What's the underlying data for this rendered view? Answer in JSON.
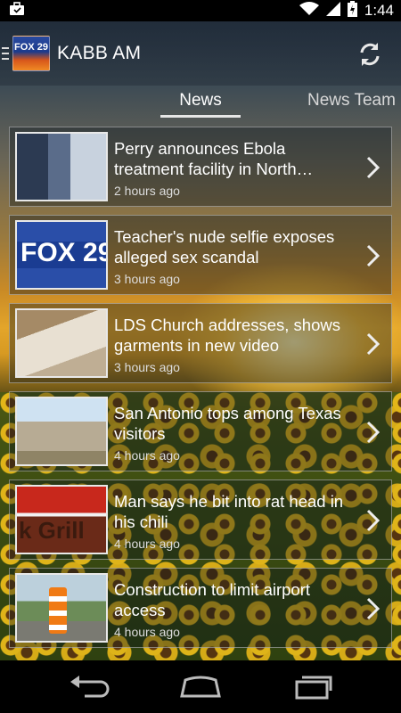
{
  "status_bar": {
    "time": "1:44",
    "left_icon": "briefcase-icon",
    "icons": [
      "wifi-icon",
      "signal-icon",
      "battery-charging-icon"
    ]
  },
  "action_bar": {
    "title": "KABB AM",
    "logo_text": "FOX 29",
    "refresh_icon": "refresh-icon"
  },
  "tabs": [
    {
      "label": "News",
      "selected": true
    },
    {
      "label": "News Team",
      "selected": false
    }
  ],
  "news": [
    {
      "headline": "Perry announces Ebola treatment facility in North…",
      "time": "2 hours ago"
    },
    {
      "headline": "Teacher's nude selfie exposes alleged sex scandal",
      "time": "3 hours ago"
    },
    {
      "headline": "LDS Church addresses, shows garments in new video",
      "time": "3 hours ago"
    },
    {
      "headline": "San Antonio tops among Texas visitors",
      "time": "4 hours ago"
    },
    {
      "headline": "Man says he bit into rat head in his chili",
      "time": "4 hours ago"
    },
    {
      "headline": "Construction to limit airport access",
      "time": "4 hours ago"
    }
  ],
  "thumb_texts": {
    "fox29": "FOX 29",
    "grill": "k Grill"
  },
  "nav_bar": [
    "back-icon",
    "home-icon",
    "recent-apps-icon"
  ]
}
